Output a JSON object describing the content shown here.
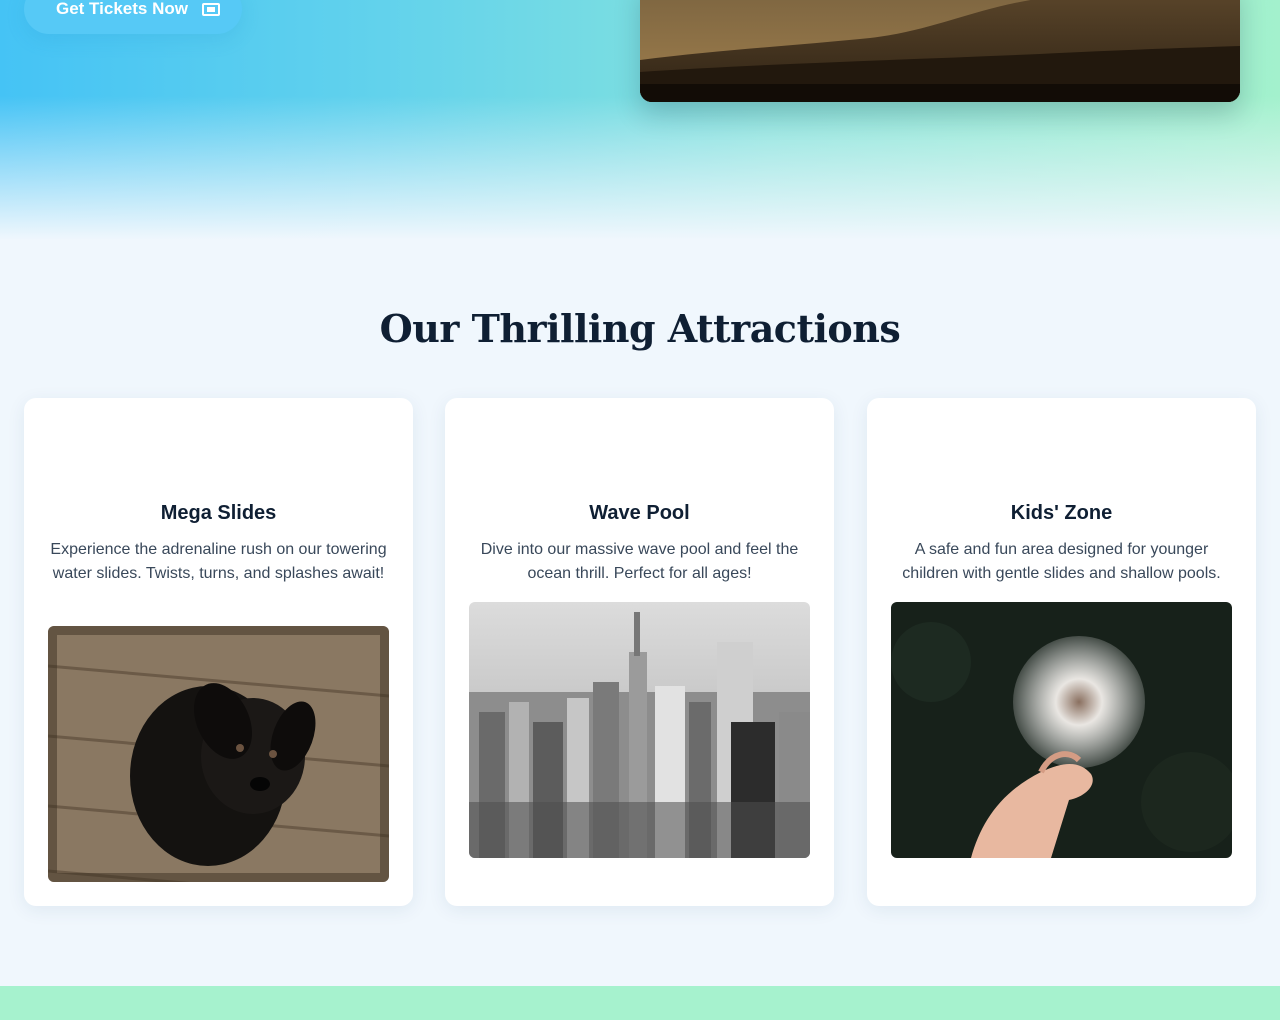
{
  "hero": {
    "cta_label": "Get Tickets Now",
    "cta_icon": "ticket-icon",
    "image_alt": "Sand dunes landscape at dusk"
  },
  "attractions": {
    "title": "Our Thrilling Attractions",
    "cards": [
      {
        "title": "Mega Slides",
        "description": "Experience the adrenaline rush on our towering water slides. Twists, turns, and splashes await!",
        "image_alt": "Black puppy on wooden floor"
      },
      {
        "title": "Wave Pool",
        "description": "Dive into our massive wave pool and feel the ocean thrill. Perfect for all ages!",
        "image_alt": "Black and white city skyline"
      },
      {
        "title": "Kids' Zone",
        "description": "A safe and fun area designed for younger children with gentle slides and shallow pools.",
        "image_alt": "Hand holding a dandelion"
      }
    ]
  },
  "colors": {
    "accent": "#56c9f6",
    "heading": "#0f1f33",
    "band": "#a6f2ce"
  }
}
